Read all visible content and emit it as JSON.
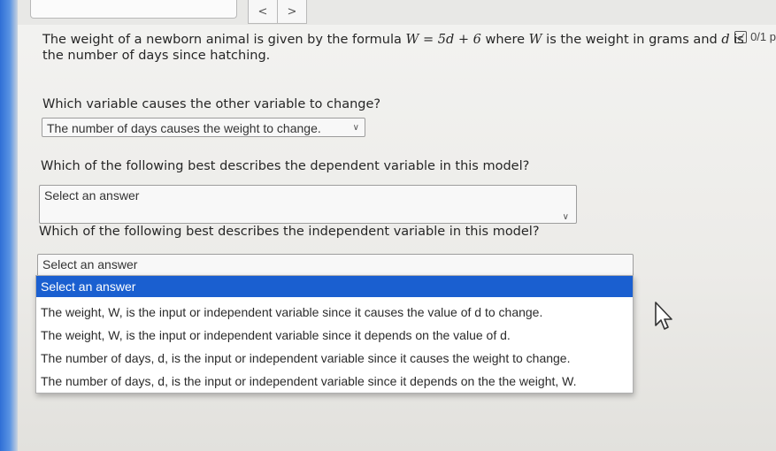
{
  "nav": {
    "prev_symbol": "<",
    "next_symbol": ">"
  },
  "score": {
    "text": "0/1 p"
  },
  "problem": {
    "text_before": "The weight of a newborn animal is given by the formula ",
    "formula": "W = 5d + 6",
    "text_middle": " where ",
    "var_w": "W",
    "text_after": " is the weight in grams and ",
    "var_d": "d",
    "text_end": " is the number of days since hatching."
  },
  "questions": [
    {
      "prompt": "Which variable causes the other variable to change?",
      "selected": "The number of days causes the weight to change."
    },
    {
      "prompt": "Which of the following best describes the dependent variable in this model?",
      "selected": "Select an answer"
    },
    {
      "prompt": "Which of the following best describes the independent variable in this model?",
      "selected": "Select an answer"
    }
  ],
  "dropdown": {
    "options": [
      "Select an answer",
      "The weight, W, is the input or independent variable since it causes the value of d to change.",
      "The weight, W, is the input or independent variable since it depends on the value of d.",
      "The number of days, d, is the input or independent variable since it causes the weight to change.",
      "The number of days, d, is the input or independent variable since it depends on the the weight, W."
    ],
    "highlighted_index": 0
  },
  "colors": {
    "highlight": "#1a5fd0",
    "screen_edge": "#2f6fd6"
  },
  "icons": {
    "chevron": "chevron-down-icon",
    "score": "checkbox-icon",
    "cursor": "mouse-pointer-icon"
  }
}
